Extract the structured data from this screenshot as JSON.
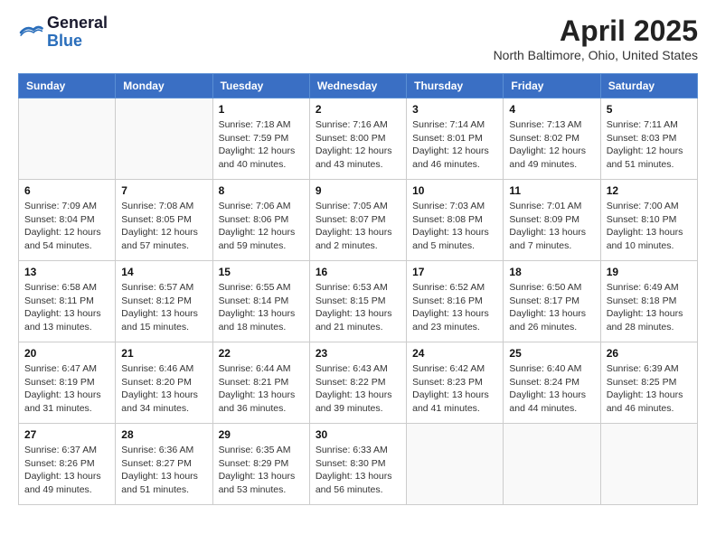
{
  "header": {
    "logo_general": "General",
    "logo_blue": "Blue",
    "month_title": "April 2025",
    "location": "North Baltimore, Ohio, United States"
  },
  "days_of_week": [
    "Sunday",
    "Monday",
    "Tuesday",
    "Wednesday",
    "Thursday",
    "Friday",
    "Saturday"
  ],
  "weeks": [
    [
      {
        "day": "",
        "info": ""
      },
      {
        "day": "",
        "info": ""
      },
      {
        "day": "1",
        "info": "Sunrise: 7:18 AM\nSunset: 7:59 PM\nDaylight: 12 hours and 40 minutes."
      },
      {
        "day": "2",
        "info": "Sunrise: 7:16 AM\nSunset: 8:00 PM\nDaylight: 12 hours and 43 minutes."
      },
      {
        "day": "3",
        "info": "Sunrise: 7:14 AM\nSunset: 8:01 PM\nDaylight: 12 hours and 46 minutes."
      },
      {
        "day": "4",
        "info": "Sunrise: 7:13 AM\nSunset: 8:02 PM\nDaylight: 12 hours and 49 minutes."
      },
      {
        "day": "5",
        "info": "Sunrise: 7:11 AM\nSunset: 8:03 PM\nDaylight: 12 hours and 51 minutes."
      }
    ],
    [
      {
        "day": "6",
        "info": "Sunrise: 7:09 AM\nSunset: 8:04 PM\nDaylight: 12 hours and 54 minutes."
      },
      {
        "day": "7",
        "info": "Sunrise: 7:08 AM\nSunset: 8:05 PM\nDaylight: 12 hours and 57 minutes."
      },
      {
        "day": "8",
        "info": "Sunrise: 7:06 AM\nSunset: 8:06 PM\nDaylight: 12 hours and 59 minutes."
      },
      {
        "day": "9",
        "info": "Sunrise: 7:05 AM\nSunset: 8:07 PM\nDaylight: 13 hours and 2 minutes."
      },
      {
        "day": "10",
        "info": "Sunrise: 7:03 AM\nSunset: 8:08 PM\nDaylight: 13 hours and 5 minutes."
      },
      {
        "day": "11",
        "info": "Sunrise: 7:01 AM\nSunset: 8:09 PM\nDaylight: 13 hours and 7 minutes."
      },
      {
        "day": "12",
        "info": "Sunrise: 7:00 AM\nSunset: 8:10 PM\nDaylight: 13 hours and 10 minutes."
      }
    ],
    [
      {
        "day": "13",
        "info": "Sunrise: 6:58 AM\nSunset: 8:11 PM\nDaylight: 13 hours and 13 minutes."
      },
      {
        "day": "14",
        "info": "Sunrise: 6:57 AM\nSunset: 8:12 PM\nDaylight: 13 hours and 15 minutes."
      },
      {
        "day": "15",
        "info": "Sunrise: 6:55 AM\nSunset: 8:14 PM\nDaylight: 13 hours and 18 minutes."
      },
      {
        "day": "16",
        "info": "Sunrise: 6:53 AM\nSunset: 8:15 PM\nDaylight: 13 hours and 21 minutes."
      },
      {
        "day": "17",
        "info": "Sunrise: 6:52 AM\nSunset: 8:16 PM\nDaylight: 13 hours and 23 minutes."
      },
      {
        "day": "18",
        "info": "Sunrise: 6:50 AM\nSunset: 8:17 PM\nDaylight: 13 hours and 26 minutes."
      },
      {
        "day": "19",
        "info": "Sunrise: 6:49 AM\nSunset: 8:18 PM\nDaylight: 13 hours and 28 minutes."
      }
    ],
    [
      {
        "day": "20",
        "info": "Sunrise: 6:47 AM\nSunset: 8:19 PM\nDaylight: 13 hours and 31 minutes."
      },
      {
        "day": "21",
        "info": "Sunrise: 6:46 AM\nSunset: 8:20 PM\nDaylight: 13 hours and 34 minutes."
      },
      {
        "day": "22",
        "info": "Sunrise: 6:44 AM\nSunset: 8:21 PM\nDaylight: 13 hours and 36 minutes."
      },
      {
        "day": "23",
        "info": "Sunrise: 6:43 AM\nSunset: 8:22 PM\nDaylight: 13 hours and 39 minutes."
      },
      {
        "day": "24",
        "info": "Sunrise: 6:42 AM\nSunset: 8:23 PM\nDaylight: 13 hours and 41 minutes."
      },
      {
        "day": "25",
        "info": "Sunrise: 6:40 AM\nSunset: 8:24 PM\nDaylight: 13 hours and 44 minutes."
      },
      {
        "day": "26",
        "info": "Sunrise: 6:39 AM\nSunset: 8:25 PM\nDaylight: 13 hours and 46 minutes."
      }
    ],
    [
      {
        "day": "27",
        "info": "Sunrise: 6:37 AM\nSunset: 8:26 PM\nDaylight: 13 hours and 49 minutes."
      },
      {
        "day": "28",
        "info": "Sunrise: 6:36 AM\nSunset: 8:27 PM\nDaylight: 13 hours and 51 minutes."
      },
      {
        "day": "29",
        "info": "Sunrise: 6:35 AM\nSunset: 8:29 PM\nDaylight: 13 hours and 53 minutes."
      },
      {
        "day": "30",
        "info": "Sunrise: 6:33 AM\nSunset: 8:30 PM\nDaylight: 13 hours and 56 minutes."
      },
      {
        "day": "",
        "info": ""
      },
      {
        "day": "",
        "info": ""
      },
      {
        "day": "",
        "info": ""
      }
    ]
  ]
}
